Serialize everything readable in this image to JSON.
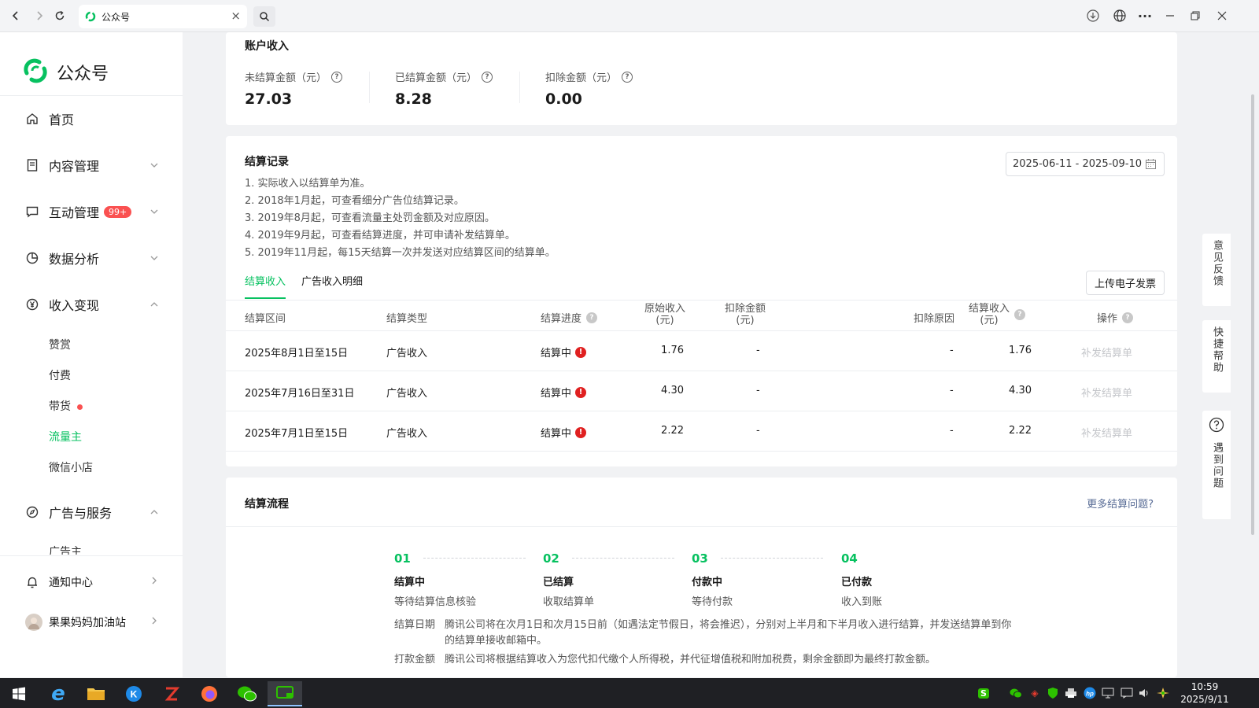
{
  "browser": {
    "tab_title": "公众号"
  },
  "sidebar": {
    "logo_text": "公众号",
    "home": "首页",
    "content_mgmt": "内容管理",
    "interaction_mgmt": "互动管理",
    "interaction_badge": "99+",
    "data_analysis": "数据分析",
    "monetization": "收入变现",
    "sub_items": [
      "赞赏",
      "付费",
      "带货",
      "流量主",
      "微信小店"
    ],
    "ads_services": "广告与服务",
    "advertiser": "广告主",
    "notifications": "通知中心",
    "account_name": "果果妈妈加油站"
  },
  "account_income": {
    "title": "账户收入",
    "unsettled_label": "未结算金额（元）",
    "unsettled_value": "27.03",
    "settled_label": "已结算金额（元）",
    "settled_value": "8.28",
    "deducted_label": "扣除金额（元）",
    "deducted_value": "0.00"
  },
  "settlement_records": {
    "title": "结算记录",
    "date_range": "2025-06-11 - 2025-09-10",
    "notes": [
      "1. 实际收入以结算单为准。",
      "2. 2018年1月起，可查看细分广告位结算记录。",
      "3. 2019年8月起，可查看流量主处罚金额及对应原因。",
      "4. 2019年9月起，可查看结算进度，并可申请补发结算单。",
      "5. 2019年11月起，每15天结算一次并发送对应结算区间的结算单。"
    ],
    "tabs": [
      "结算收入",
      "广告收入明细"
    ],
    "upload_button": "上传电子发票",
    "columns": {
      "period": "结算区间",
      "type": "结算类型",
      "progress": "结算进度",
      "original_a": "原始收入",
      "original_b": "(元)",
      "deduct_a": "扣除金额",
      "deduct_b": "(元)",
      "reason": "扣除原因",
      "income_a": "结算收入",
      "income_b": "(元)",
      "action": "操作"
    },
    "rows": [
      {
        "period": "2025年8月1日至15日",
        "type": "广告收入",
        "progress": "结算中",
        "original": "1.76",
        "deduct": "-",
        "reason": "-",
        "income": "1.76",
        "action": "补发结算单"
      },
      {
        "period": "2025年7月16日至31日",
        "type": "广告收入",
        "progress": "结算中",
        "original": "4.30",
        "deduct": "-",
        "reason": "-",
        "income": "4.30",
        "action": "补发结算单"
      },
      {
        "period": "2025年7月1日至15日",
        "type": "广告收入",
        "progress": "结算中",
        "original": "2.22",
        "deduct": "-",
        "reason": "-",
        "income": "2.22",
        "action": "补发结算单"
      }
    ]
  },
  "settlement_flow": {
    "title": "结算流程",
    "more_link": "更多结算问题?",
    "steps": [
      {
        "num": "01",
        "name": "结算中",
        "desc": "等待结算信息核验"
      },
      {
        "num": "02",
        "name": "已结算",
        "desc": "收取结算单"
      },
      {
        "num": "03",
        "name": "付款中",
        "desc": "等待付款"
      },
      {
        "num": "04",
        "name": "已付款",
        "desc": "收入到账"
      }
    ],
    "date_label": "结算日期",
    "date_text_1": "腾讯公司将在次月1日和次月15日前（如遇法定节假日，将会推迟），分别对上半月和下半月收入进行结算，并发送结算单到你",
    "date_text_2": "的结算单接收邮箱中。",
    "pay_label": "打款金额",
    "pay_text": "腾讯公司将根据结算收入为您代扣代缴个人所得税，并代征增值税和附加税费，剩余金额即为最终打款金额。"
  },
  "float_buttons": {
    "feedback": "意见反馈",
    "help": "快捷帮助",
    "problem": "遇到问题"
  },
  "taskbar": {
    "time": "10:59",
    "date": "2025/9/11"
  },
  "colors": {
    "accent": "#07c160",
    "badge": "#fa5151",
    "link": "#576b95"
  }
}
